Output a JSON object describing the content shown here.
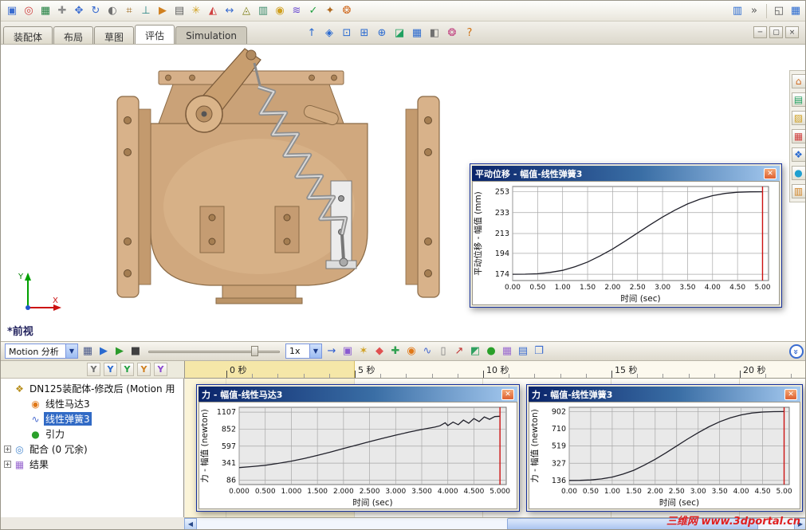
{
  "toolbar_top": {
    "icons": [
      {
        "name": "insert-component-icon",
        "glyph": "▣",
        "color": "#3a6cd0"
      },
      {
        "name": "mate-icon",
        "glyph": "◎",
        "color": "#d04040"
      },
      {
        "name": "linear-pattern-icon",
        "glyph": "▦",
        "color": "#208040"
      },
      {
        "name": "smart-fasteners-icon",
        "glyph": "✚",
        "color": "#8a8a8a"
      },
      {
        "name": "move-component-icon",
        "glyph": "✥",
        "color": "#3a6cd0"
      },
      {
        "name": "rotate-component-icon",
        "glyph": "↻",
        "color": "#3a6cd0"
      },
      {
        "name": "show-hidden-components-icon",
        "glyph": "◐",
        "color": "#707070"
      },
      {
        "name": "assembly-features-icon",
        "glyph": "⌗",
        "color": "#a06a20"
      },
      {
        "name": "reference-geometry-icon",
        "glyph": "⊥",
        "color": "#208080"
      },
      {
        "name": "new-motion-study-icon",
        "glyph": "▶",
        "color": "#d08020"
      },
      {
        "name": "bill-of-materials-icon",
        "glyph": "▤",
        "color": "#606060"
      },
      {
        "name": "exploded-view-icon",
        "glyph": "✳",
        "color": "#d0a020"
      },
      {
        "name": "interference-detection-icon",
        "glyph": "◭",
        "color": "#d04040"
      },
      {
        "name": "measure-icon",
        "glyph": "↔",
        "color": "#3a6cd0"
      },
      {
        "name": "mass-properties-icon",
        "glyph": "◬",
        "color": "#80801a"
      },
      {
        "name": "section-properties-icon",
        "glyph": "▥",
        "color": "#3a8a6a"
      },
      {
        "name": "sensor-icon",
        "glyph": "◉",
        "color": "#d0a020"
      },
      {
        "name": "design-study-icon",
        "glyph": "≋",
        "color": "#6a4ad0"
      },
      {
        "name": "simulation-advisor-icon",
        "glyph": "✓",
        "color": "#20a040"
      },
      {
        "name": "instant3d-icon",
        "glyph": "✦",
        "color": "#b06a20"
      },
      {
        "name": "render-tools-icon",
        "glyph": "❂",
        "color": "#d06a20"
      }
    ],
    "right_icons": [
      {
        "name": "help-book-icon",
        "glyph": "▥",
        "color": "#2a6ad0"
      },
      {
        "name": "toolbar-options-icon",
        "glyph": "»",
        "color": "#555555"
      }
    ],
    "corner_icons": [
      {
        "name": "cascade-windows-icon",
        "glyph": "◱",
        "color": "#555555"
      },
      {
        "name": "taskpane-toggle-icon",
        "glyph": "▦",
        "color": "#2a6ad0"
      }
    ]
  },
  "tab_bar": {
    "tabs": [
      {
        "name": "tab-assembly",
        "label": "装配体",
        "state": "normal"
      },
      {
        "name": "tab-layout",
        "label": "布局",
        "state": "normal"
      },
      {
        "name": "tab-sketch",
        "label": "草图",
        "state": "normal"
      },
      {
        "name": "tab-evaluate",
        "label": "评估",
        "state": "active"
      },
      {
        "name": "tab-simulation",
        "label": "Simulation",
        "state": "pressed"
      }
    ]
  },
  "view_toolbar": {
    "icons": [
      {
        "name": "orientation-arrow-icon",
        "glyph": "↑",
        "color": "#2a6ad0"
      },
      {
        "name": "view-cube-icon",
        "glyph": "◈",
        "color": "#2a6ad0"
      },
      {
        "name": "zoom-fit-icon",
        "glyph": "⊡",
        "color": "#2a6ad0"
      },
      {
        "name": "zoom-area-icon",
        "glyph": "⊞",
        "color": "#2a6ad0"
      },
      {
        "name": "zoom-in-out-icon",
        "glyph": "⊕",
        "color": "#2a6ad0"
      },
      {
        "name": "section-view-icon",
        "glyph": "◪",
        "color": "#20a060"
      },
      {
        "name": "view-orientation-icon",
        "glyph": "▦",
        "color": "#2a6ad0"
      },
      {
        "name": "display-style-icon",
        "glyph": "◧",
        "color": "#707070"
      },
      {
        "name": "edit-appearance-icon",
        "glyph": "❂",
        "color": "#c04080"
      },
      {
        "name": "help-icon",
        "glyph": "?",
        "color": "#d07010"
      }
    ]
  },
  "window_controls": {
    "buttons": [
      {
        "name": "minimize-button",
        "glyph": "─",
        "color": "#444444"
      },
      {
        "name": "restore-button",
        "glyph": "▢",
        "color": "#444444"
      },
      {
        "name": "close-button",
        "glyph": "×",
        "color": "#444444"
      }
    ]
  },
  "right_toolbar": {
    "icons": [
      {
        "name": "taskpane-home-icon",
        "glyph": "⌂",
        "color": "#d06a20"
      },
      {
        "name": "design-library-icon",
        "glyph": "▤",
        "color": "#20a060"
      },
      {
        "name": "file-explorer-icon",
        "glyph": "▨",
        "color": "#d0a020"
      },
      {
        "name": "view-palette-icon",
        "glyph": "▦",
        "color": "#d04040"
      },
      {
        "name": "appearances-icon",
        "glyph": "❖",
        "color": "#2a6ad0"
      },
      {
        "name": "scenes-icon",
        "glyph": "●",
        "color": "#20a0d0"
      },
      {
        "name": "custom-properties-icon",
        "glyph": "▥",
        "color": "#d08020"
      }
    ]
  },
  "viewport": {
    "view_label": "*前视",
    "triad": {
      "x_label": "X",
      "y_label": "Y"
    }
  },
  "motion": {
    "study_type_value": "Motion 分析",
    "speed_value": "1x",
    "icons_pre": [
      {
        "name": "calculate-motion-icon",
        "glyph": "▦",
        "color": "#4a5a8a"
      },
      {
        "name": "play-from-start-icon",
        "glyph": "▶",
        "color": "#2a6ad0"
      },
      {
        "name": "play-icon",
        "glyph": "▶",
        "color": "#2a9a2a"
      },
      {
        "name": "stop-icon",
        "glyph": "■",
        "color": "#404040"
      }
    ],
    "icons_post": [
      {
        "name": "playback-mode-icon",
        "glyph": "→",
        "color": "#2a5ad0"
      },
      {
        "name": "save-animation-icon",
        "glyph": "▣",
        "color": "#8a5ad0"
      },
      {
        "name": "animation-wizard-icon",
        "glyph": "✶",
        "color": "#d0a020"
      },
      {
        "name": "autokey-icon",
        "glyph": "◆",
        "color": "#e05050"
      },
      {
        "name": "add-key-icon",
        "glyph": "✚",
        "color": "#30a050"
      },
      {
        "name": "motor-icon",
        "glyph": "◉",
        "color": "#e07818"
      },
      {
        "name": "spring-icon",
        "glyph": "∿",
        "color": "#4a6cd0"
      },
      {
        "name": "damper-icon",
        "glyph": "▯",
        "color": "#808080"
      },
      {
        "name": "force-icon",
        "glyph": "↗",
        "color": "#c03030"
      },
      {
        "name": "contact-icon",
        "glyph": "◩",
        "color": "#30a060"
      },
      {
        "name": "gravity-icon",
        "glyph": "●",
        "color": "#2aa02a"
      },
      {
        "name": "results-plots-icon",
        "glyph": "▦",
        "color": "#9a6ad0"
      },
      {
        "name": "event-based-view-icon",
        "glyph": "▤",
        "color": "#3a6cd0"
      },
      {
        "name": "copy-study-icon",
        "glyph": "❐",
        "color": "#3a6cd0"
      }
    ],
    "collapse_glyph": "»"
  },
  "filters": {
    "icons": [
      {
        "name": "filter-all-icon",
        "glyph": "Y",
        "color": "#707070"
      },
      {
        "name": "filter-animated-icon",
        "glyph": "Y",
        "color": "#2a6ad0"
      },
      {
        "name": "filter-driving-icon",
        "glyph": "Y",
        "color": "#20a040"
      },
      {
        "name": "filter-selected-icon",
        "glyph": "Y",
        "color": "#d08020"
      },
      {
        "name": "filter-results-icon",
        "glyph": "Y",
        "color": "#8a4ad0"
      }
    ]
  },
  "timeline": {
    "ticks": [
      {
        "t": 0,
        "label": "0 秒"
      },
      {
        "t": 5,
        "label": "5 秒"
      },
      {
        "t": 10,
        "label": "10 秒"
      },
      {
        "t": 15,
        "label": "15 秒"
      },
      {
        "t": 20,
        "label": "20 秒"
      }
    ],
    "highlight_range_sec": [
      0,
      5
    ]
  },
  "tree": {
    "items": [
      {
        "name": "tree-item-assembly-root",
        "label": "DN125装配体-修改后 (Motion 用",
        "glyph": "❖",
        "color": "#b89020",
        "depth": 0,
        "expander": ""
      },
      {
        "name": "tree-item-linear-motor",
        "label": "线性马达3",
        "glyph": "◉",
        "color": "#e07818",
        "depth": 1,
        "expander": ""
      },
      {
        "name": "tree-item-linear-spring",
        "label": "线性弹簧3",
        "glyph": "∿",
        "color": "#4a6cd0",
        "depth": 1,
        "expander": "",
        "selected": true
      },
      {
        "name": "tree-item-gravity",
        "label": "引力",
        "glyph": "●",
        "color": "#2aa02a",
        "depth": 1,
        "expander": ""
      },
      {
        "name": "tree-item-mates",
        "label": "配合 (0 冗余)",
        "glyph": "◎",
        "color": "#4a8ad0",
        "depth": 0,
        "expander": "+"
      },
      {
        "name": "tree-item-results",
        "label": "结果",
        "glyph": "▦",
        "color": "#9a6ad0",
        "depth": 0,
        "expander": "+"
      }
    ]
  },
  "chart_data": [
    {
      "type": "line",
      "title": "平动位移 - 幅值-线性弹簧3",
      "ylabel": "平动位移 - 幅值 (mm)",
      "xlabel": "时间 (sec)",
      "yticks": [
        174,
        194,
        213,
        233,
        253
      ],
      "ytick_labels": [
        "174",
        "194",
        "213",
        "233",
        "253"
      ],
      "xticks": [
        0,
        0.5,
        1,
        1.5,
        2,
        2.5,
        3,
        3.5,
        4,
        4.5,
        5
      ],
      "xtick_labels": [
        "0.00",
        "0.50",
        "1.00",
        "1.50",
        "2.00",
        "2.50",
        "3.00",
        "3.50",
        "4.00",
        "4.50",
        "5.00"
      ],
      "xlim": [
        0,
        5.12
      ],
      "ylim": [
        168,
        258
      ],
      "plot_bg": "#ffffff",
      "line_color": "#20202a",
      "marker_x": 5.0,
      "grid": true,
      "legend": "none",
      "series": [
        {
          "name": "线性弹簧3",
          "points": [
            [
              0,
              174
            ],
            [
              0.25,
              174.1
            ],
            [
              0.5,
              174.5
            ],
            [
              0.75,
              175.8
            ],
            [
              1,
              177.8
            ],
            [
              1.25,
              181.3
            ],
            [
              1.5,
              185.7
            ],
            [
              1.75,
              191.6
            ],
            [
              2,
              198.2
            ],
            [
              2.25,
              205.7
            ],
            [
              2.5,
              213.5
            ],
            [
              2.75,
              221.3
            ],
            [
              3,
              228.8
            ],
            [
              3.25,
              235.4
            ],
            [
              3.5,
              241.3
            ],
            [
              3.75,
              245.9
            ],
            [
              4,
              249.2
            ],
            [
              4.25,
              251.4
            ],
            [
              4.5,
              252.5
            ],
            [
              4.75,
              252.9
            ],
            [
              5,
              253
            ]
          ]
        }
      ]
    },
    {
      "type": "line",
      "title": "力 - 幅值-线性马达3",
      "ylabel": "力 - 幅值 (newton)",
      "xlabel": "时间 (sec)",
      "yticks": [
        86,
        341,
        597,
        852,
        1107
      ],
      "ytick_labels": [
        "86",
        "341",
        "597",
        "852",
        "1107"
      ],
      "xticks": [
        0,
        0.5,
        1,
        1.5,
        2,
        2.5,
        3,
        3.5,
        4,
        4.5,
        5
      ],
      "xtick_labels": [
        "0.000",
        "0.500",
        "1.000",
        "1.500",
        "2.000",
        "2.500",
        "3.000",
        "3.500",
        "4.000",
        "4.500",
        "5.000"
      ],
      "xlim": [
        0,
        5.12
      ],
      "ylim": [
        20,
        1180
      ],
      "plot_bg": "#e9e9e9",
      "line_color": "#20202a",
      "marker_x": 5.0,
      "grid": true,
      "legend": "none",
      "series": [
        {
          "name": "线性马达3",
          "points": [
            [
              0,
              275
            ],
            [
              0.25,
              290
            ],
            [
              0.5,
              310
            ],
            [
              0.75,
              338
            ],
            [
              1,
              372
            ],
            [
              1.25,
              412
            ],
            [
              1.5,
              458
            ],
            [
              1.75,
              508
            ],
            [
              2,
              560
            ],
            [
              2.25,
              612
            ],
            [
              2.5,
              664
            ],
            [
              2.75,
              714
            ],
            [
              3,
              762
            ],
            [
              3.25,
              806
            ],
            [
              3.5,
              846
            ],
            [
              3.75,
              882
            ],
            [
              3.85,
              902
            ],
            [
              3.95,
              948
            ],
            [
              4,
              905
            ],
            [
              4.1,
              958
            ],
            [
              4.2,
              918
            ],
            [
              4.3,
              988
            ],
            [
              4.4,
              940
            ],
            [
              4.5,
              1010
            ],
            [
              4.6,
              965
            ],
            [
              4.7,
              1035
            ],
            [
              4.8,
              1000
            ],
            [
              4.9,
              1040
            ],
            [
              5,
              1045
            ]
          ]
        }
      ]
    },
    {
      "type": "line",
      "title": "力 - 幅值-线性弹簧3",
      "ylabel": "力 - 幅值 (newton)",
      "xlabel": "时间 (sec)",
      "yticks": [
        136,
        327,
        519,
        710,
        902
      ],
      "ytick_labels": [
        "136",
        "327",
        "519",
        "710",
        "902"
      ],
      "xticks": [
        0,
        0.5,
        1,
        1.5,
        2,
        2.5,
        3,
        3.5,
        4,
        4.5,
        5
      ],
      "xtick_labels": [
        "0.00",
        "0.50",
        "1.00",
        "1.50",
        "2.00",
        "2.50",
        "3.00",
        "3.50",
        "4.00",
        "4.50",
        "5.00"
      ],
      "xlim": [
        0,
        5.12
      ],
      "ylim": [
        90,
        950
      ],
      "plot_bg": "#e9e9e9",
      "line_color": "#20202a",
      "marker_x": 5.0,
      "grid": true,
      "legend": "none",
      "series": [
        {
          "name": "线性弹簧3",
          "points": [
            [
              0,
              136
            ],
            [
              0.25,
              137
            ],
            [
              0.5,
              141
            ],
            [
              0.75,
              153
            ],
            [
              1,
              173
            ],
            [
              1.25,
              206
            ],
            [
              1.5,
              249
            ],
            [
              1.75,
              306
            ],
            [
              2,
              371
            ],
            [
              2.25,
              443
            ],
            [
              2.5,
              519
            ],
            [
              2.75,
              595
            ],
            [
              3,
              667
            ],
            [
              3.25,
              733
            ],
            [
              3.5,
              789
            ],
            [
              3.75,
              832
            ],
            [
              4,
              865
            ],
            [
              4.25,
              886
            ],
            [
              4.5,
              897
            ],
            [
              4.75,
              901
            ],
            [
              5,
              902
            ]
          ]
        }
      ]
    }
  ],
  "watermark": {
    "text": "三维网 www.3dportal.cn"
  }
}
